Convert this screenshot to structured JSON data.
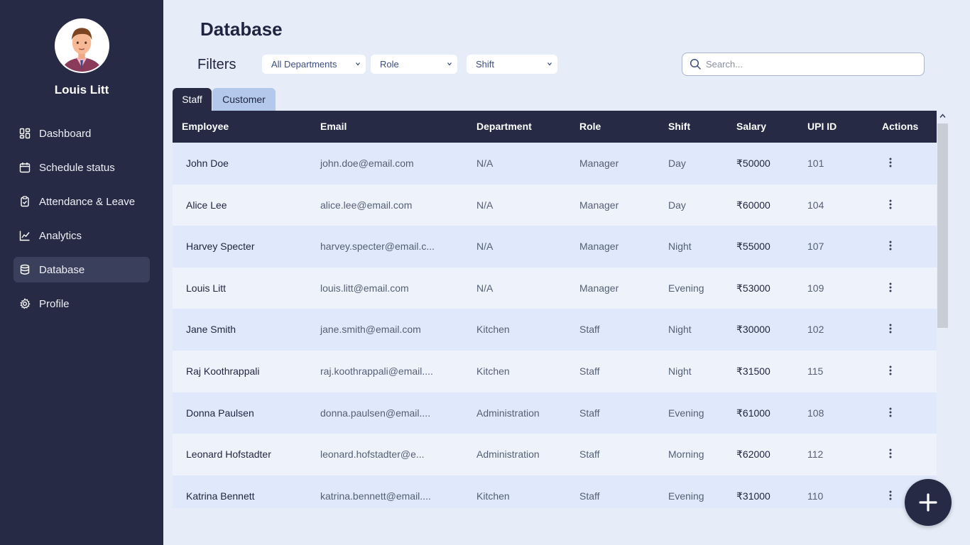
{
  "user": {
    "name": "Louis Litt"
  },
  "nav": [
    {
      "label": "Dashboard",
      "icon": "dashboard-icon"
    },
    {
      "label": "Schedule status",
      "icon": "calendar-icon"
    },
    {
      "label": "Attendance & Leave",
      "icon": "clipboard-check-icon"
    },
    {
      "label": "Analytics",
      "icon": "line-chart-icon"
    },
    {
      "label": "Database",
      "icon": "database-icon",
      "active": true
    },
    {
      "label": "Profile",
      "icon": "gear-icon"
    }
  ],
  "page": {
    "title": "Database"
  },
  "filters": {
    "label": "Filters",
    "department": "All Departments",
    "role": "Role",
    "shift": "Shift"
  },
  "search": {
    "placeholder": "Search..."
  },
  "tabs": {
    "staff": "Staff",
    "customer": "Customer"
  },
  "table": {
    "headers": {
      "employee": "Employee",
      "email": "Email",
      "department": "Department",
      "role": "Role",
      "shift": "Shift",
      "salary": "Salary",
      "upi": "UPI ID",
      "actions": "Actions"
    },
    "rows": [
      {
        "name": "John Doe",
        "email": "john.doe@email.com",
        "department": "N/A",
        "role": "Manager",
        "shift": "Day",
        "salary": "₹50000",
        "upi": "101"
      },
      {
        "name": "Alice Lee",
        "email": "alice.lee@email.com",
        "department": "N/A",
        "role": "Manager",
        "shift": "Day",
        "salary": "₹60000",
        "upi": "104"
      },
      {
        "name": "Harvey Specter",
        "email": "harvey.specter@email.c...",
        "department": "N/A",
        "role": "Manager",
        "shift": "Night",
        "salary": "₹55000",
        "upi": "107"
      },
      {
        "name": "Louis Litt",
        "email": "louis.litt@email.com",
        "department": "N/A",
        "role": "Manager",
        "shift": "Evening",
        "salary": "₹53000",
        "upi": "109"
      },
      {
        "name": "Jane Smith",
        "email": "jane.smith@email.com",
        "department": "Kitchen",
        "role": "Staff",
        "shift": "Night",
        "salary": "₹30000",
        "upi": "102"
      },
      {
        "name": "Raj Koothrappali",
        "email": "raj.koothrappali@email....",
        "department": "Kitchen",
        "role": "Staff",
        "shift": "Night",
        "salary": "₹31500",
        "upi": "115"
      },
      {
        "name": "Donna Paulsen",
        "email": "donna.paulsen@email....",
        "department": "Administration",
        "role": "Staff",
        "shift": "Evening",
        "salary": "₹61000",
        "upi": "108"
      },
      {
        "name": "Leonard Hofstadter",
        "email": "leonard.hofstadter@e...",
        "department": "Administration",
        "role": "Staff",
        "shift": "Morning",
        "salary": "₹62000",
        "upi": "112"
      },
      {
        "name": "Katrina Bennett",
        "email": "katrina.bennett@email....",
        "department": "Kitchen",
        "role": "Staff",
        "shift": "Evening",
        "salary": "₹31000",
        "upi": "110"
      }
    ]
  },
  "colors": {
    "sidebar": "#262a45",
    "background": "#e6edf8",
    "accent": "#b3c8ea"
  }
}
